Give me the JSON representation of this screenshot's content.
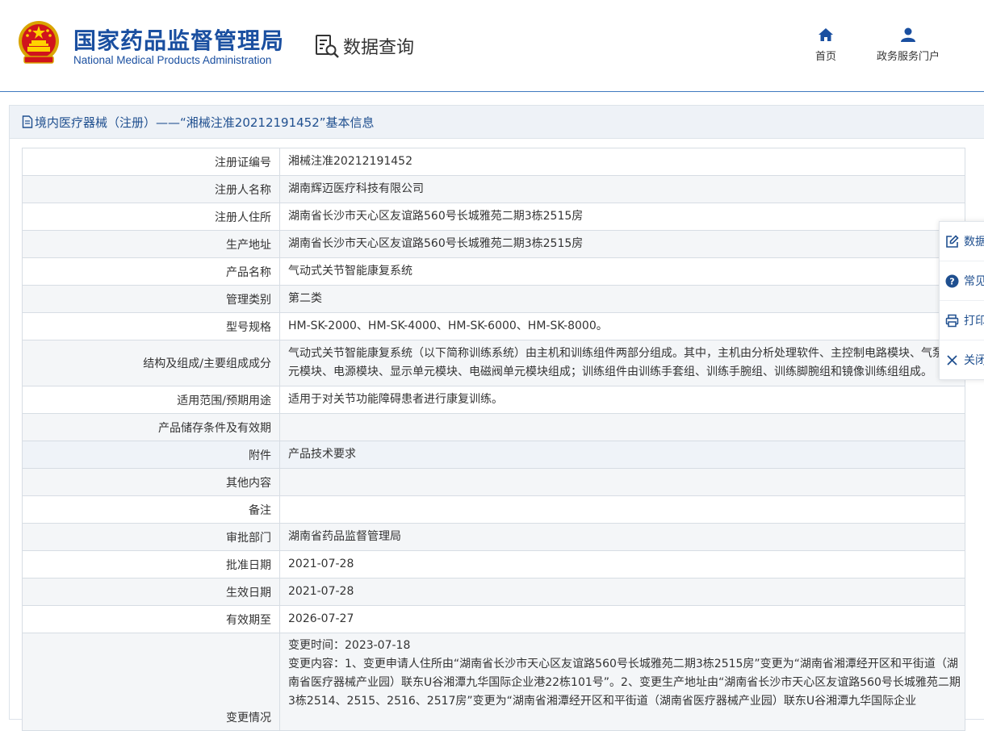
{
  "header": {
    "org_name_cn": "国家药品监督管理局",
    "org_name_en": "National Medical Products Administration",
    "section_title": "数据查询",
    "nav": [
      {
        "label": "首页",
        "icon": "home-icon"
      },
      {
        "label": "政务服务门户",
        "icon": "user-icon"
      }
    ]
  },
  "panel": {
    "title": "境内医疗器械（注册）——“湘械注准20212191452”基本信息"
  },
  "details": {
    "rows": [
      {
        "label": "注册证编号",
        "value": "湘械注准20212191452"
      },
      {
        "label": "注册人名称",
        "value": "湖南辉迈医疗科技有限公司"
      },
      {
        "label": "注册人住所",
        "value": "湖南省长沙市天心区友谊路560号长城雅苑二期3栋2515房"
      },
      {
        "label": "生产地址",
        "value": "湖南省长沙市天心区友谊路560号长城雅苑二期3栋2515房"
      },
      {
        "label": "产品名称",
        "value": "气动式关节智能康复系统"
      },
      {
        "label": "管理类别",
        "value": "第二类"
      },
      {
        "label": "型号规格",
        "value": "HM-SK-2000、HM-SK-4000、HM-SK-6000、HM-SK-8000。"
      },
      {
        "label": "结构及组成/主要组成成分",
        "value": "气动式关节智能康复系统（以下简称训练系统）由主机和训练组件两部分组成。其中，主机由分析处理软件、主控制电路模块、气泵单元模块、电源模块、显示单元模块、电磁阀单元模块组成；训练组件由训练手套组、训练手腕组、训练脚腕组和镜像训练组组成。"
      },
      {
        "label": "适用范围/预期用途",
        "value": "适用于对关节功能障碍患者进行康复训练。"
      },
      {
        "label": "产品储存条件及有效期",
        "value": ""
      },
      {
        "label": "附件",
        "value": "产品技术要求"
      },
      {
        "label": "其他内容",
        "value": ""
      },
      {
        "label": "备注",
        "value": ""
      },
      {
        "label": "审批部门",
        "value": "湖南省药品监督管理局"
      },
      {
        "label": "批准日期",
        "value": "2021-07-28"
      },
      {
        "label": "生效日期",
        "value": "2021-07-28"
      },
      {
        "label": "有效期至",
        "value": "2026-07-27"
      },
      {
        "label": "变更情况",
        "value_time": "变更时间：2023-07-18",
        "value": "变更内容：1、变更申请人住所由“湖南省长沙市天心区友谊路560号长城雅苑二期3栋2515房”变更为“湖南省湘潭经开区和平街道（湖南省医疗器械产业园）联东U谷湘潭九华国际企业港22栋101号”。2、变更生产地址由“湖南省长沙市天心区友谊路560号长城雅苑二期3栋2514、2515、2516、2517房”变更为“湖南省湘潭经开区和平街道（湖南省医疗器械产业园）联东U谷湘潭九华国际企业"
      }
    ]
  },
  "float_menu": [
    {
      "label": "数据",
      "icon": "edit-icon"
    },
    {
      "label": "常见",
      "icon": "help-icon"
    },
    {
      "label": "打印",
      "icon": "print-icon"
    },
    {
      "label": "关闭",
      "icon": "close-icon"
    }
  ],
  "colors": {
    "brand": "#1a4fa0",
    "header_border": "#3f7ac0",
    "panel_head_bg": "#eef2f7"
  }
}
